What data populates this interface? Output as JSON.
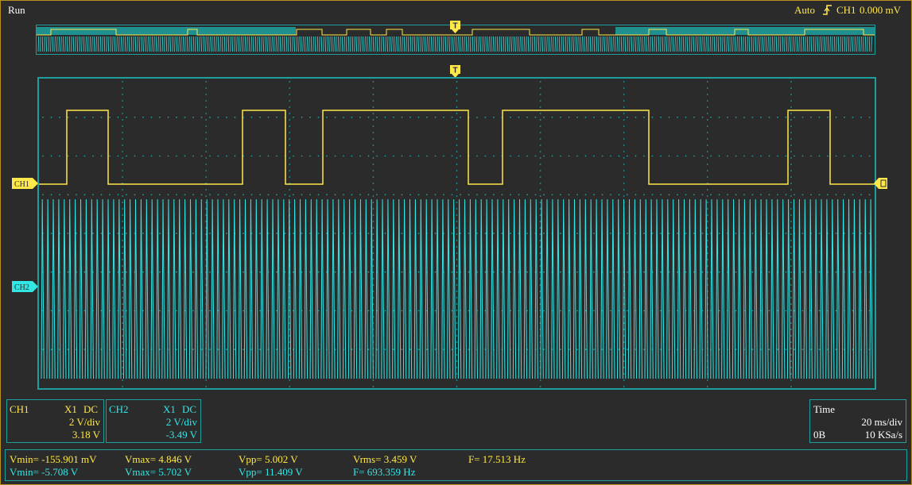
{
  "status": {
    "run_label": "Run",
    "trigger_mode": "Auto",
    "trigger_source": "CH1",
    "trigger_level": "0.000 mV"
  },
  "channels": {
    "ch1": {
      "marker": "CH1",
      "name": "CH1",
      "probe": "X1",
      "coupling": "DC",
      "scale": "2 V/div",
      "offset": "3.18 V",
      "color": "#ffe84a"
    },
    "ch2": {
      "marker": "CH2",
      "name": "CH2",
      "probe": "X1",
      "coupling": "DC",
      "scale": "2 V/div",
      "offset": "-3.49 V",
      "color": "#33e6e6"
    }
  },
  "timebase": {
    "title": "Time",
    "scale": "20 ms/div",
    "memory": "0B",
    "sample_rate": "10 KSa/s"
  },
  "measurements": {
    "ch1": {
      "vmin": "Vmin= -155.901 mV",
      "vmax": "Vmax= 4.846 V",
      "vpp": "Vpp= 5.002 V",
      "vrms": "Vrms= 3.459 V",
      "freq": "F= 17.513 Hz"
    },
    "ch2": {
      "vmin": "Vmin= -5.708 V",
      "vmax": "Vmax= 5.702 V",
      "vpp": "Vpp= 11.409 V",
      "freq": "F= 693.359 Hz"
    }
  },
  "trigger_marker": "T",
  "colors": {
    "frame": "#b8901f",
    "grid_border": "#1f9e9e",
    "ch1": "#ffe84a",
    "ch2": "#33e6e6",
    "background": "#2b2b2b"
  }
}
